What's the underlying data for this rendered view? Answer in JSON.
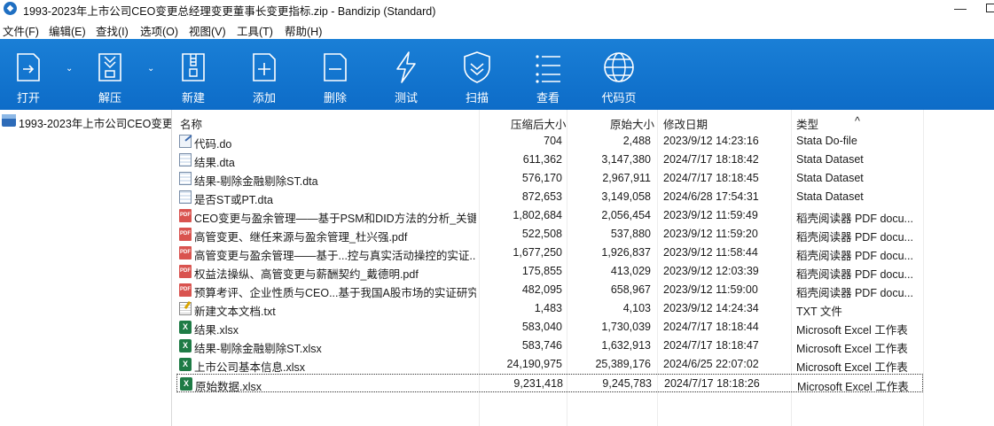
{
  "window": {
    "title": "1993-2023年上市公司CEO变更总经理变更董事长变更指标.zip - Bandizip (Standard)",
    "minimize_glyph": "—"
  },
  "menu": [
    "文件(F)",
    "编辑(E)",
    "查找(I)",
    "选项(O)",
    "视图(V)",
    "工具(T)",
    "帮助(H)"
  ],
  "toolbar": {
    "background": "#1377d0",
    "buttons": [
      {
        "label": "打开",
        "icon": "open-icon",
        "dropdown": true
      },
      {
        "label": "解压",
        "icon": "extract-icon",
        "dropdown": true
      },
      {
        "label": "新建",
        "icon": "new-archive-icon",
        "dropdown": false
      },
      {
        "label": "添加",
        "icon": "add-icon",
        "dropdown": false
      },
      {
        "label": "删除",
        "icon": "delete-icon",
        "dropdown": false
      },
      {
        "label": "测试",
        "icon": "test-icon",
        "dropdown": false
      },
      {
        "label": "扫描",
        "icon": "scan-icon",
        "dropdown": false
      },
      {
        "label": "查看",
        "icon": "view-icon",
        "dropdown": false
      },
      {
        "label": "代码页",
        "icon": "codepage-icon",
        "dropdown": false
      }
    ]
  },
  "tree": {
    "root_label": "1993-2023年上市公司CEO变更",
    "root_icon_text": "ZIP"
  },
  "columns": {
    "name": "名称",
    "packed": "压缩后大小",
    "original": "原始大小",
    "modified": "修改日期",
    "type": "类型",
    "sort_indicator": "^"
  },
  "files": [
    {
      "name": "代码.do",
      "packed": "704",
      "original": "2,488",
      "modified": "2023/9/12 14:23:16",
      "type": "Stata Do-file",
      "icon": "do"
    },
    {
      "name": "结果.dta",
      "packed": "611,362",
      "original": "3,147,380",
      "modified": "2024/7/17 18:18:42",
      "type": "Stata Dataset",
      "icon": "dta"
    },
    {
      "name": "结果-剔除金融剔除ST.dta",
      "packed": "576,170",
      "original": "2,967,911",
      "modified": "2024/7/17 18:18:45",
      "type": "Stata Dataset",
      "icon": "dta"
    },
    {
      "name": "是否ST或PT.dta",
      "packed": "872,653",
      "original": "3,149,058",
      "modified": "2024/6/28 17:54:31",
      "type": "Stata Dataset",
      "icon": "dta"
    },
    {
      "name": "CEO变更与盈余管理——基于PSM和DID方法的分析_关键...",
      "packed": "1,802,684",
      "original": "2,056,454",
      "modified": "2023/9/12 11:59:49",
      "type": "稻壳阅读器 PDF docu...",
      "icon": "pdf"
    },
    {
      "name": "高管变更、继任来源与盈余管理_杜兴强.pdf",
      "packed": "522,508",
      "original": "537,880",
      "modified": "2023/9/12 11:59:20",
      "type": "稻壳阅读器 PDF docu...",
      "icon": "pdf"
    },
    {
      "name": "高管变更与盈余管理——基于...控与真实活动操控的实证...",
      "packed": "1,677,250",
      "original": "1,926,837",
      "modified": "2023/9/12 11:58:44",
      "type": "稻壳阅读器 PDF docu...",
      "icon": "pdf"
    },
    {
      "name": "权益法操纵、高管变更与薪酬契约_戴德明.pdf",
      "packed": "175,855",
      "original": "413,029",
      "modified": "2023/9/12 12:03:39",
      "type": "稻壳阅读器 PDF docu...",
      "icon": "pdf"
    },
    {
      "name": "预算考评、企业性质与CEO...基于我国A股市场的实证研究...",
      "packed": "482,095",
      "original": "658,967",
      "modified": "2023/9/12 11:59:00",
      "type": "稻壳阅读器 PDF docu...",
      "icon": "pdf"
    },
    {
      "name": "新建文本文档.txt",
      "packed": "1,483",
      "original": "4,103",
      "modified": "2023/9/12 14:24:34",
      "type": "TXT 文件",
      "icon": "txt"
    },
    {
      "name": "结果.xlsx",
      "packed": "583,040",
      "original": "1,730,039",
      "modified": "2024/7/17 18:18:44",
      "type": "Microsoft Excel 工作表",
      "icon": "xls"
    },
    {
      "name": "结果-剔除金融剔除ST.xlsx",
      "packed": "583,746",
      "original": "1,632,913",
      "modified": "2024/7/17 18:18:47",
      "type": "Microsoft Excel 工作表",
      "icon": "xls"
    },
    {
      "name": "上市公司基本信息.xlsx",
      "packed": "24,190,975",
      "original": "25,389,176",
      "modified": "2024/6/25 22:07:02",
      "type": "Microsoft Excel 工作表",
      "icon": "xls"
    },
    {
      "name": "原始数据.xlsx",
      "packed": "9,231,418",
      "original": "9,245,783",
      "modified": "2024/7/17 18:18:26",
      "type": "Microsoft Excel 工作表",
      "icon": "xls",
      "selected": true
    }
  ],
  "icon_text": {
    "pdf": "PDF",
    "xls": "X"
  }
}
